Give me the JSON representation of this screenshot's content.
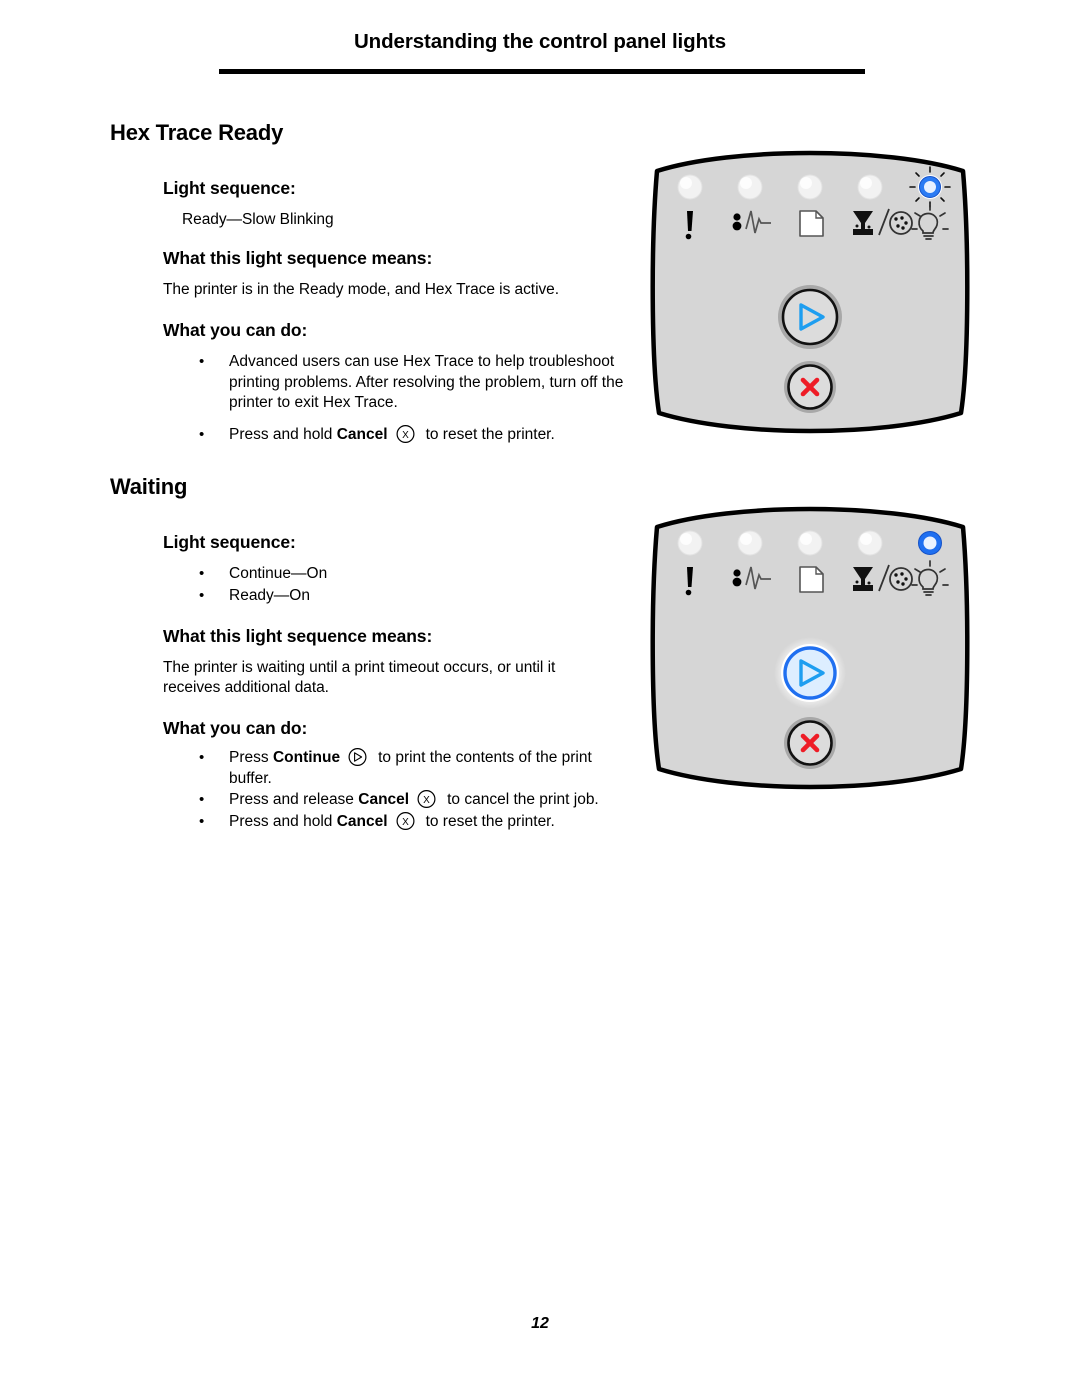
{
  "header": {
    "running_title": "Understanding the control panel lights"
  },
  "page_number": "12",
  "labels": {
    "light_sequence": "Light sequence:",
    "what_means": "What this light sequence means:",
    "what_you_can_do": "What you can do:",
    "bullet_char": "•"
  },
  "sections": [
    {
      "title": "Hex Trace Ready",
      "light_sequence_text": "Ready—Slow Blinking",
      "light_sequence_items": [],
      "meaning": "The printer is in the Ready mode, and Hex Trace is active.",
      "actions": [
        {
          "pre": "Advanced users can use Hex Trace to help troubleshoot printing problems. After resolving the problem, turn off the printer to exit Hex Trace.",
          "keyword": "",
          "icon": "",
          "post": ""
        },
        {
          "pre": "Press and hold ",
          "keyword": "Cancel",
          "icon": "cancel-x-icon",
          "post": "to reset the printer."
        }
      ],
      "panel": {
        "leds": [
          {
            "name": "error-led",
            "icon": "exclamation-icon",
            "state": "off"
          },
          {
            "name": "paper-jam-led",
            "icon": "paper-jam-icon",
            "state": "off"
          },
          {
            "name": "load-paper-led",
            "icon": "paper-icon",
            "state": "off"
          },
          {
            "name": "toner-led",
            "icon": "toner-drum-icon",
            "state": "off"
          },
          {
            "name": "ready-led",
            "icon": "lightbulb-icon",
            "state": "blinking"
          }
        ],
        "continue_button": {
          "name": "continue-button",
          "icon": "triangle-right-icon",
          "state": "off"
        },
        "cancel_button": {
          "name": "cancel-button",
          "icon": "x-icon",
          "state": "off"
        }
      }
    },
    {
      "title": "Waiting",
      "light_sequence_text": "",
      "light_sequence_items": [
        "Continue—On",
        "Ready—On"
      ],
      "meaning": "The printer is waiting until a print timeout occurs, or until it receives additional data.",
      "actions": [
        {
          "pre": "Press ",
          "keyword": "Continue",
          "icon": "continue-triangle-icon",
          "post": "to print the contents of the print buffer."
        },
        {
          "pre": "Press and release ",
          "keyword": "Cancel",
          "icon": "cancel-x-icon",
          "post": "to cancel the print job."
        },
        {
          "pre": "Press and hold ",
          "keyword": "Cancel",
          "icon": "cancel-x-icon",
          "post": "to reset the printer."
        }
      ],
      "panel": {
        "leds": [
          {
            "name": "error-led",
            "icon": "exclamation-icon",
            "state": "off"
          },
          {
            "name": "paper-jam-led",
            "icon": "paper-jam-icon",
            "state": "off"
          },
          {
            "name": "load-paper-led",
            "icon": "paper-icon",
            "state": "off"
          },
          {
            "name": "toner-led",
            "icon": "toner-drum-icon",
            "state": "off"
          },
          {
            "name": "ready-led",
            "icon": "lightbulb-icon",
            "state": "on"
          }
        ],
        "continue_button": {
          "name": "continue-button",
          "icon": "triangle-right-icon",
          "state": "on"
        },
        "cancel_button": {
          "name": "cancel-button",
          "icon": "x-icon",
          "state": "off"
        }
      }
    }
  ],
  "colors": {
    "led_blue": "#1f6ff0",
    "led_blue_light": "#7fb4ff",
    "triangle_blue": "#1e9ef0",
    "cancel_red": "#ee1c26",
    "panel_fill": "#d6d6d6",
    "panel_stroke": "#000000",
    "ring_gray": "#9a9a9a",
    "led_off_fill": "#f2f2f2"
  }
}
